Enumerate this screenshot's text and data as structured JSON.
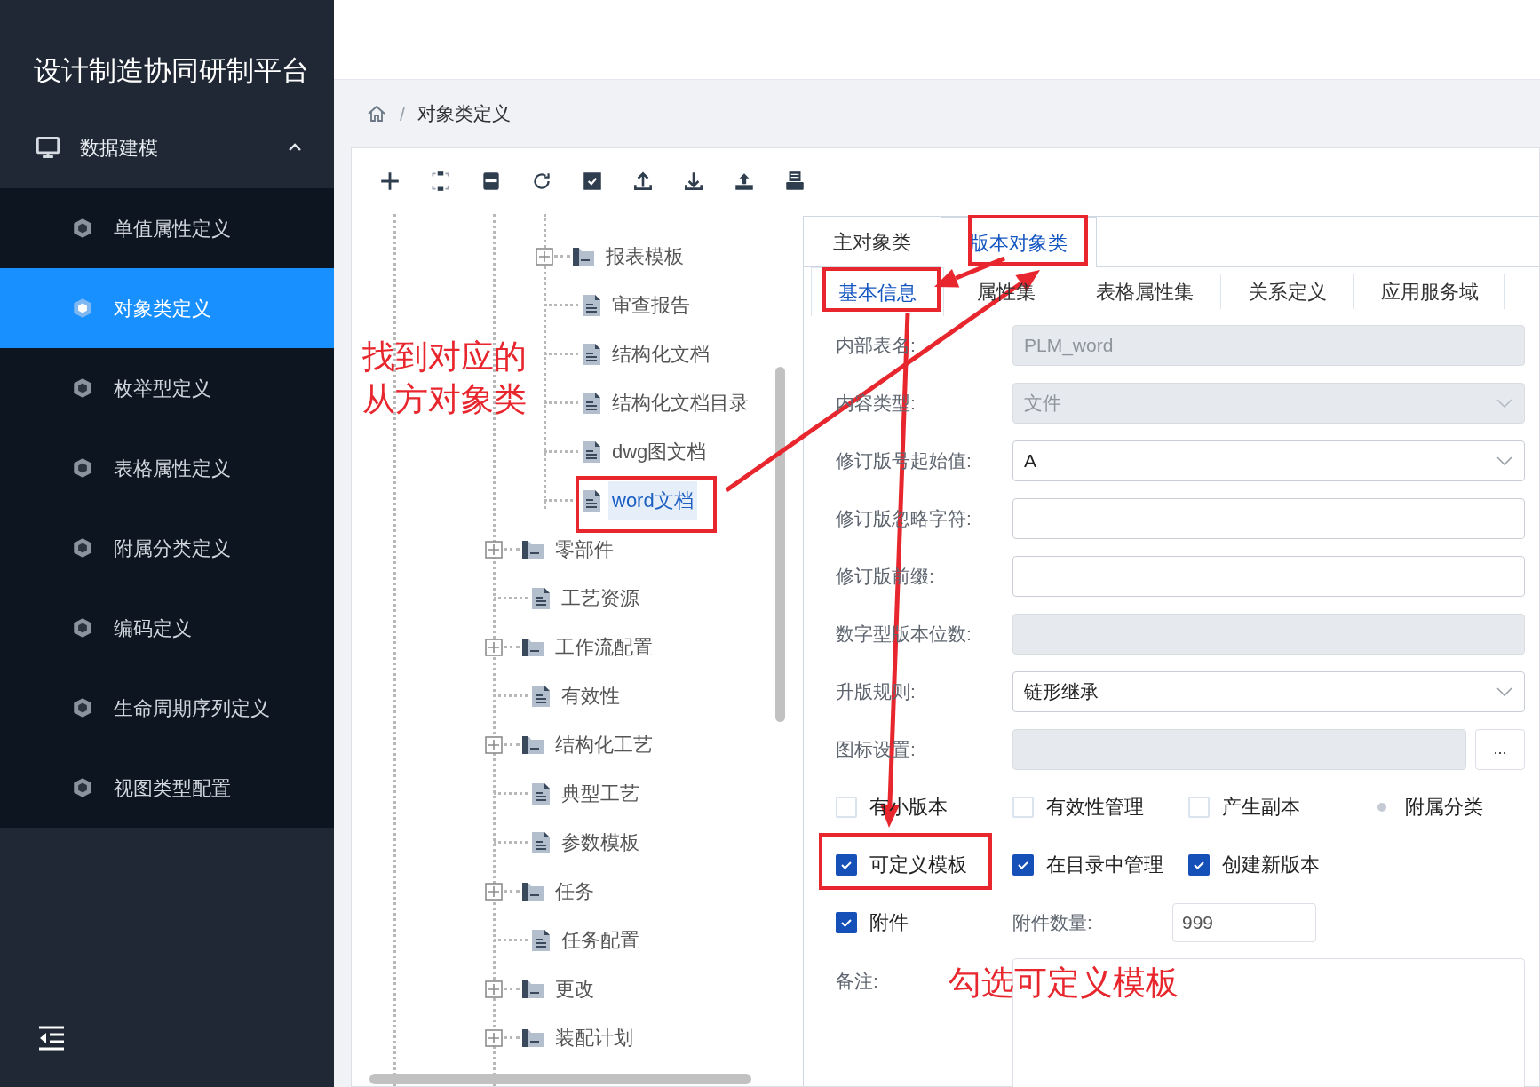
{
  "sidebar": {
    "title": "设计制造协同研制平台",
    "menu": {
      "label": "数据建模",
      "expanded": true,
      "items": [
        {
          "label": "单值属性定义",
          "selected": false
        },
        {
          "label": "对象类定义",
          "selected": true
        },
        {
          "label": "枚举型定义",
          "selected": false
        },
        {
          "label": "表格属性定义",
          "selected": false
        },
        {
          "label": "附属分类定义",
          "selected": false
        },
        {
          "label": "编码定义",
          "selected": false
        },
        {
          "label": "生命周期序列定义",
          "selected": false
        },
        {
          "label": "视图类型配置",
          "selected": false
        }
      ]
    }
  },
  "breadcrumb": {
    "separator": "/",
    "items": [
      "对象类定义"
    ]
  },
  "tree": {
    "sub_items": [
      {
        "label": "报表模板",
        "kind": "folder",
        "selected": false
      },
      {
        "label": "审查报告",
        "kind": "file",
        "selected": false
      },
      {
        "label": "结构化文档",
        "kind": "file",
        "selected": false
      },
      {
        "label": "结构化文档目录",
        "kind": "file",
        "selected": false
      },
      {
        "label": "dwg图文档",
        "kind": "file",
        "selected": false
      },
      {
        "label": "word文档",
        "kind": "file",
        "selected": true
      }
    ],
    "items": [
      {
        "label": "零部件",
        "kind": "folder",
        "selected": false
      },
      {
        "label": "工艺资源",
        "kind": "file",
        "selected": false
      },
      {
        "label": "工作流配置",
        "kind": "folder",
        "selected": false
      },
      {
        "label": "有效性",
        "kind": "file",
        "selected": false
      },
      {
        "label": "结构化工艺",
        "kind": "folder",
        "selected": false
      },
      {
        "label": "典型工艺",
        "kind": "file",
        "selected": false
      },
      {
        "label": "参数模板",
        "kind": "file",
        "selected": false
      },
      {
        "label": "任务",
        "kind": "folder",
        "selected": false
      },
      {
        "label": "任务配置",
        "kind": "file",
        "selected": false
      },
      {
        "label": "更改",
        "kind": "folder",
        "selected": false
      },
      {
        "label": "装配计划",
        "kind": "folder",
        "selected": false
      }
    ]
  },
  "tabs": [
    {
      "label": "主对象类",
      "selected": false
    },
    {
      "label": "版本对象类",
      "selected": true
    }
  ],
  "subtabs": [
    {
      "label": "基本信息",
      "selected": true
    },
    {
      "label": "属性集",
      "selected": false
    },
    {
      "label": "表格属性集",
      "selected": false
    },
    {
      "label": "关系定义",
      "selected": false
    },
    {
      "label": "应用服务域",
      "selected": false
    }
  ],
  "form": {
    "fields": [
      {
        "label": "内部表名:",
        "value": "PLM_word",
        "kind": "text",
        "disabled": true
      },
      {
        "label": "内容类型:",
        "value": "文件",
        "kind": "select",
        "disabled": true
      },
      {
        "label": "修订版号起始值:",
        "value": "A",
        "kind": "select",
        "disabled": false
      },
      {
        "label": "修订版忽略字符:",
        "kind": "text",
        "disabled": false
      },
      {
        "label": "修订版前缀:",
        "kind": "text",
        "disabled": false
      },
      {
        "label": "数字型版本位数:",
        "kind": "text",
        "disabled": true
      },
      {
        "label": "升版规则:",
        "value": "链形继承",
        "kind": "select",
        "disabled": false
      },
      {
        "label": "图标设置:",
        "kind": "picker",
        "disabled": true,
        "button": "..."
      }
    ],
    "options": [
      [
        {
          "label": "有小版本",
          "kind": "checkbox",
          "checked": false
        },
        {
          "label": "有效性管理",
          "kind": "checkbox",
          "checked": false
        },
        {
          "label": "产生副本",
          "kind": "checkbox",
          "checked": false
        },
        {
          "label": "附属分类",
          "kind": "dot"
        }
      ],
      [
        {
          "label": "可定义模板",
          "kind": "checkbox",
          "checked": true
        },
        {
          "label": "在目录中管理",
          "kind": "checkbox",
          "checked": true
        },
        {
          "label": "创建新版本",
          "kind": "checkbox",
          "checked": true
        }
      ]
    ],
    "attachment": {
      "label": "附件",
      "checked": true,
      "count_label": "附件数量:",
      "count": "999"
    },
    "remark": {
      "label": "备注:"
    }
  },
  "annotations": [
    "找到对应的从方对象类",
    "勾选可定义模板"
  ]
}
